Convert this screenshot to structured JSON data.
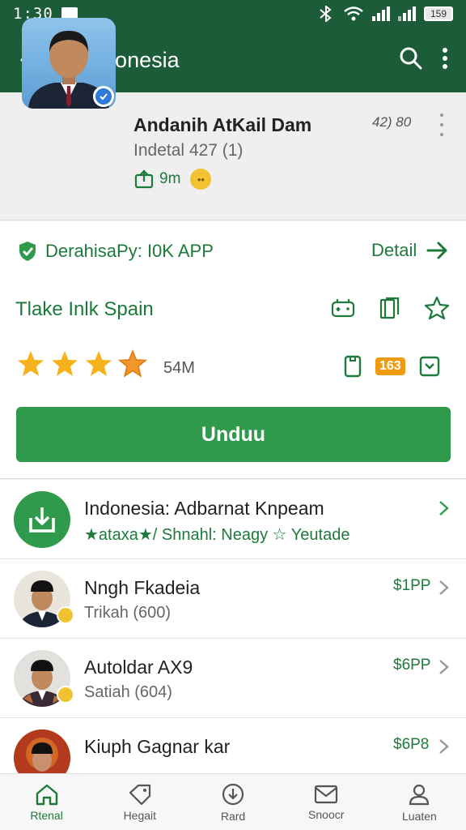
{
  "status_bar": {
    "time": "1:30",
    "battery": "159"
  },
  "app_bar": {
    "title": "APddonesia",
    "back_icon": "arrow-left-icon",
    "search_icon": "search-icon",
    "menu_icon": "more-vertical-icon"
  },
  "app": {
    "name": "Andanih AtKail Dam",
    "subtitle": "Indetal 427 (1)",
    "meta": "9m",
    "count": "42) 80"
  },
  "verified": {
    "label": "DerahisaPy: I0K APP",
    "icon": "check-shield-icon"
  },
  "detail": {
    "label": "Detail"
  },
  "tagline": "Tlake Inlk Spain",
  "rating": {
    "stars": 4,
    "max": 5,
    "downloads": "54M"
  },
  "content_rating": "163",
  "install_button": "Unduu",
  "list": {
    "items": [
      {
        "name": "Indonesia: Adbarnat Knpeam",
        "sub": "★ataxa★/ Shnahl: Neagy ☆ Yeutade",
        "price": "",
        "type": "download"
      },
      {
        "name": "Nngh Fkadeia",
        "sub": "Trikah (600)",
        "price": "$1PP",
        "type": "person"
      },
      {
        "name": "Autoldar AX9",
        "sub": "Satiah (604)",
        "price": "$6PP",
        "type": "person"
      },
      {
        "name": "Kiuph Gagnar kar",
        "sub": "",
        "price": "$6P8",
        "type": "person"
      }
    ]
  },
  "bottom_nav": [
    {
      "label": "Rtenal",
      "icon": "home-icon",
      "active": true
    },
    {
      "label": "Hegait",
      "icon": "tag-icon",
      "active": false
    },
    {
      "label": "Rard",
      "icon": "download-circle-icon",
      "active": false
    },
    {
      "label": "Snoocr",
      "icon": "mail-icon",
      "active": false
    },
    {
      "label": "Luaten",
      "icon": "user-icon",
      "active": false
    }
  ],
  "colors": {
    "primary": "#1d5c38",
    "accent": "#2f9a4c",
    "star": "#f6b21b",
    "age_badge": "#f09a10"
  }
}
